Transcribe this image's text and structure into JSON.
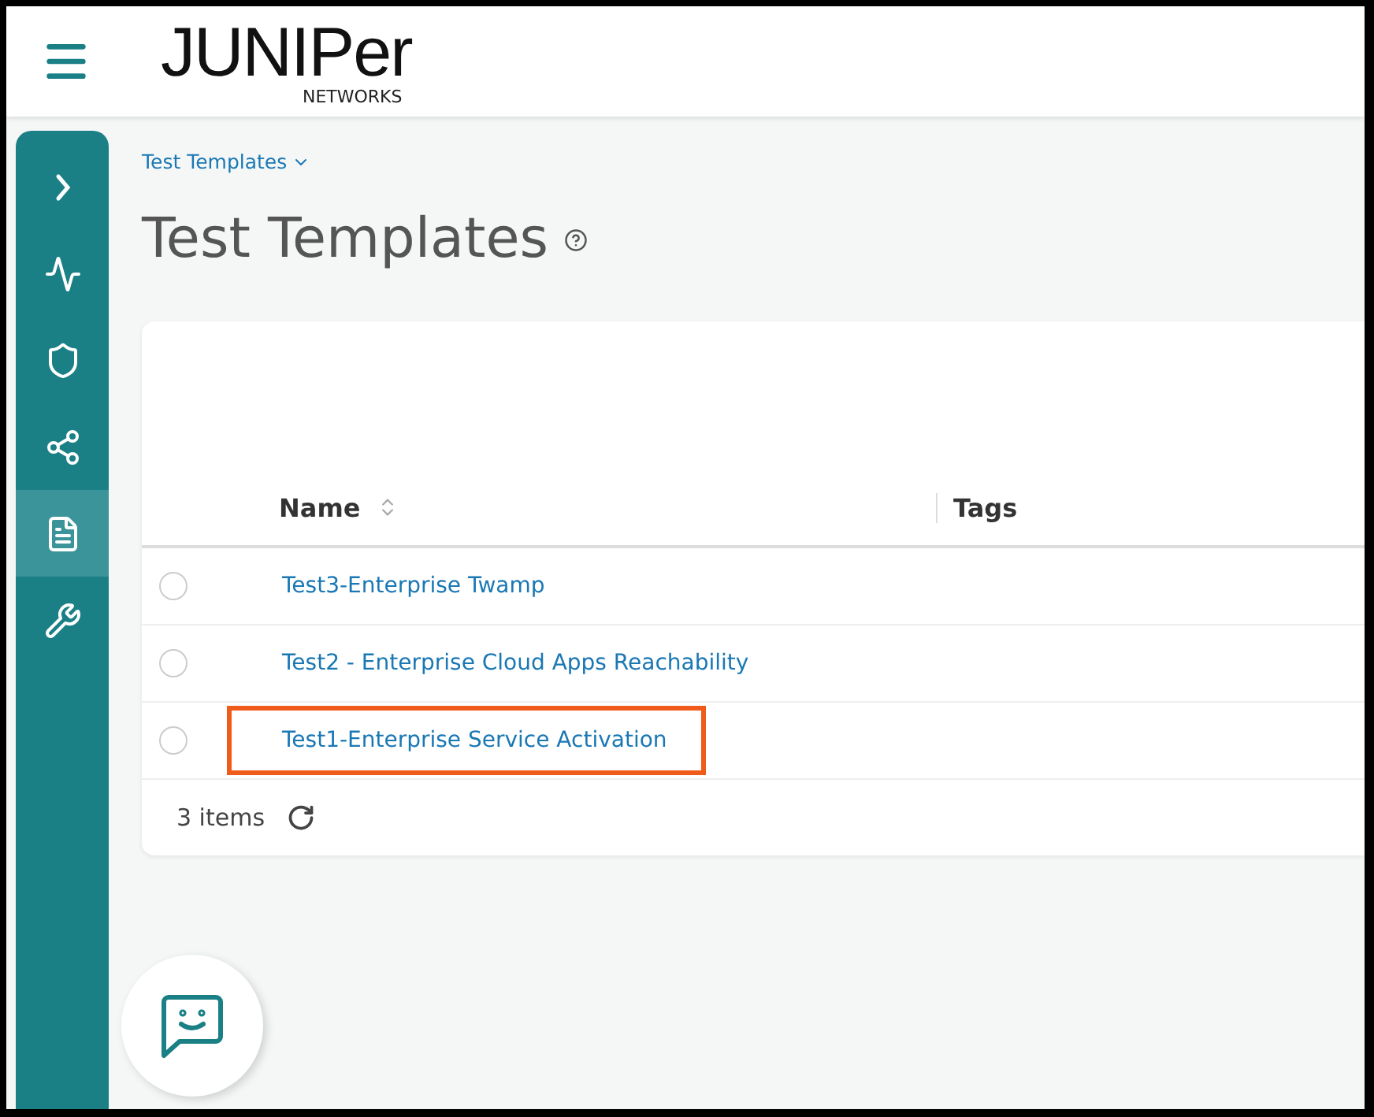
{
  "header": {
    "logo": {
      "brand": "JUNIPer",
      "sub": "NETWORKS"
    }
  },
  "sidebar": {
    "items": [
      {
        "kind": "expand",
        "selected": false
      },
      {
        "kind": "monitor",
        "selected": false
      },
      {
        "kind": "shield",
        "selected": false
      },
      {
        "kind": "share",
        "selected": false
      },
      {
        "kind": "document",
        "selected": true
      },
      {
        "kind": "tools",
        "selected": false
      }
    ]
  },
  "breadcrumb": "Test Templates",
  "title": "Test Templates",
  "table": {
    "columns": [
      "Name",
      "Tags"
    ],
    "rows": [
      {
        "name": "Test3-Enterprise Twamp",
        "selected": false,
        "highlighted": false
      },
      {
        "name": "Test2 - Enterprise Cloud Apps Reachability",
        "selected": false,
        "highlighted": false
      },
      {
        "name": "Test1-Enterprise Service Activation",
        "selected": false,
        "highlighted": true
      }
    ],
    "footer": "3 items"
  }
}
